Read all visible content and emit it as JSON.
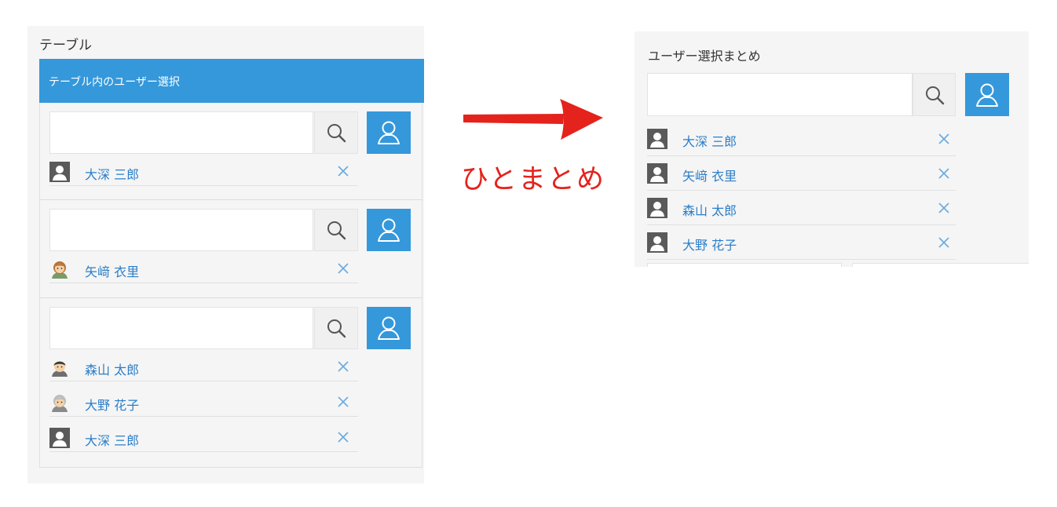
{
  "left": {
    "title": "テーブル",
    "table_header": "テーブル内のユーザー選択",
    "cells": [
      {
        "users": [
          {
            "name": "大深 三郎",
            "avatar": "default-user-icon"
          }
        ]
      },
      {
        "users": [
          {
            "name": "矢﨑 衣里",
            "avatar": "woman-avatar"
          }
        ]
      },
      {
        "users": [
          {
            "name": "森山 太郎",
            "avatar": "man-avatar"
          },
          {
            "name": "大野 花子",
            "avatar": "elderly-woman-avatar"
          },
          {
            "name": "大深 三郎",
            "avatar": "default-user-icon"
          }
        ]
      }
    ]
  },
  "caption": "ひとまとめ",
  "right": {
    "title": "ユーザー選択まとめ",
    "users": [
      {
        "name": "大深 三郎",
        "avatar": "default-user-icon"
      },
      {
        "name": "矢﨑 衣里",
        "avatar": "default-user-icon"
      },
      {
        "name": "森山 太郎",
        "avatar": "default-user-icon"
      },
      {
        "name": "大野 花子",
        "avatar": "default-user-icon"
      }
    ]
  },
  "icons": {
    "search": "search-icon",
    "user_select": "user-select-icon",
    "remove": "close-icon",
    "arrow": "arrow-right-icon"
  },
  "colors": {
    "accent_blue": "#3498db",
    "link_blue": "#2b7ec8",
    "panel_bg": "#f5f5f5",
    "arrow_red": "#e4231c"
  }
}
